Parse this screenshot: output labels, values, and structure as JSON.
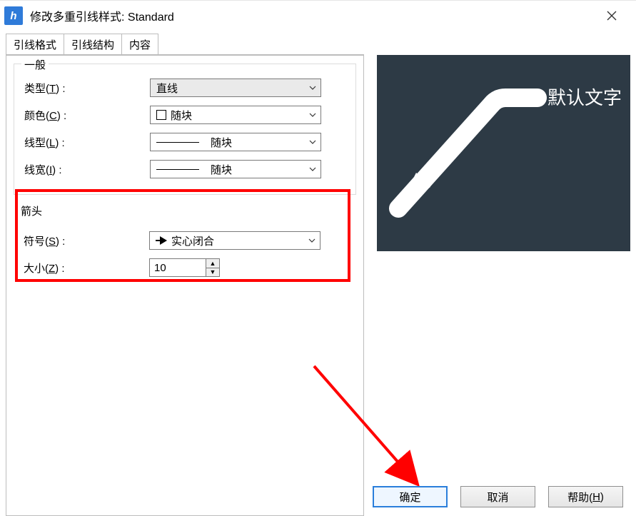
{
  "window": {
    "title": "修改多重引线样式: Standard"
  },
  "tabs": {
    "t1": "引线格式",
    "t2": "引线结构",
    "t3": "内容"
  },
  "groups": {
    "general": {
      "legend": "一般",
      "type_label_pre": "类型(",
      "type_key": "T",
      "type_label_post": ") :",
      "type_value": "直线",
      "color_label_pre": "颜色(",
      "color_key": "C",
      "color_label_post": ") :",
      "color_value": "随块",
      "ltype_label_pre": "线型(",
      "ltype_key": "L",
      "ltype_label_post": ") :",
      "ltype_value": "随块",
      "lweight_label_pre": "线宽(",
      "lweight_key": "I",
      "lweight_label_post": ") :",
      "lweight_value": "随块"
    },
    "arrow": {
      "legend": "箭头",
      "symbol_label_pre": "符号(",
      "symbol_key": "S",
      "symbol_label_post": ") :",
      "symbol_value": "实心闭合",
      "size_label_pre": "大小(",
      "size_key": "Z",
      "size_label_post": ") :",
      "size_value": "10"
    }
  },
  "preview": {
    "text": "默认文字"
  },
  "buttons": {
    "ok": "确定",
    "cancel": "取消",
    "help_pre": "帮助(",
    "help_key": "H",
    "help_post": ")"
  },
  "icons": {
    "app": "h"
  }
}
